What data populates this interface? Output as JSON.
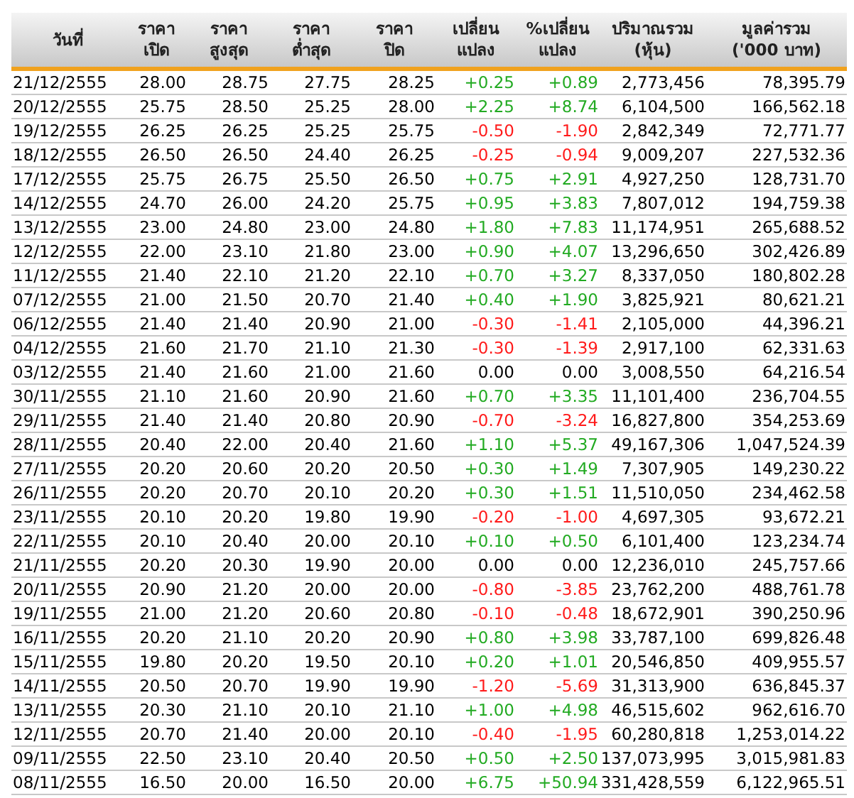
{
  "table": {
    "columns": [
      {
        "lines": [
          "วันที่"
        ]
      },
      {
        "lines": [
          "ราคา",
          "เปิด"
        ]
      },
      {
        "lines": [
          "ราคา",
          "สูงสุด"
        ]
      },
      {
        "lines": [
          "ราคา",
          "ต่ำสุด"
        ]
      },
      {
        "lines": [
          "ราคา",
          "ปิด"
        ]
      },
      {
        "lines": [
          "เปลี่ยน",
          "แปลง"
        ]
      },
      {
        "lines": [
          "%เปลี่ยน",
          "แปลง"
        ]
      },
      {
        "lines": [
          "ปริมาณรวม",
          "(หุ้น)"
        ]
      },
      {
        "lines": [
          "มูลค่ารวม",
          "('000 บาท)"
        ]
      }
    ],
    "rows": [
      {
        "date": "21/12/2555",
        "open": "28.00",
        "high": "28.75",
        "low": "27.75",
        "close": "28.25",
        "change": "+0.25",
        "pct": "+0.89",
        "volume": "2,773,456",
        "value": "78,395.79",
        "color": "#22aa22"
      },
      {
        "date": "20/12/2555",
        "open": "25.75",
        "high": "28.50",
        "low": "25.25",
        "close": "28.00",
        "change": "+2.25",
        "pct": "+8.74",
        "volume": "6,104,500",
        "value": "166,562.18",
        "color": "#22aa22"
      },
      {
        "date": "19/12/2555",
        "open": "26.25",
        "high": "26.25",
        "low": "25.25",
        "close": "25.75",
        "change": "-0.50",
        "pct": "-1.90",
        "volume": "2,842,349",
        "value": "72,771.77",
        "color": "#ff1a1a"
      },
      {
        "date": "18/12/2555",
        "open": "26.50",
        "high": "26.50",
        "low": "24.40",
        "close": "26.25",
        "change": "-0.25",
        "pct": "-0.94",
        "volume": "9,009,207",
        "value": "227,532.36",
        "color": "#ff1a1a"
      },
      {
        "date": "17/12/2555",
        "open": "25.75",
        "high": "26.75",
        "low": "25.50",
        "close": "26.50",
        "change": "+0.75",
        "pct": "+2.91",
        "volume": "4,927,250",
        "value": "128,731.70",
        "color": "#22aa22"
      },
      {
        "date": "14/12/2555",
        "open": "24.70",
        "high": "26.00",
        "low": "24.20",
        "close": "25.75",
        "change": "+0.95",
        "pct": "+3.83",
        "volume": "7,807,012",
        "value": "194,759.38",
        "color": "#22aa22"
      },
      {
        "date": "13/12/2555",
        "open": "23.00",
        "high": "24.80",
        "low": "23.00",
        "close": "24.80",
        "change": "+1.80",
        "pct": "+7.83",
        "volume": "11,174,951",
        "value": "265,688.52",
        "color": "#22aa22"
      },
      {
        "date": "12/12/2555",
        "open": "22.00",
        "high": "23.10",
        "low": "21.80",
        "close": "23.00",
        "change": "+0.90",
        "pct": "+4.07",
        "volume": "13,296,650",
        "value": "302,426.89",
        "color": "#22aa22"
      },
      {
        "date": "11/12/2555",
        "open": "21.40",
        "high": "22.10",
        "low": "21.20",
        "close": "22.10",
        "change": "+0.70",
        "pct": "+3.27",
        "volume": "8,337,050",
        "value": "180,802.28",
        "color": "#22aa22"
      },
      {
        "date": "07/12/2555",
        "open": "21.00",
        "high": "21.50",
        "low": "20.70",
        "close": "21.40",
        "change": "+0.40",
        "pct": "+1.90",
        "volume": "3,825,921",
        "value": "80,621.21",
        "color": "#22aa22"
      },
      {
        "date": "06/12/2555",
        "open": "21.40",
        "high": "21.40",
        "low": "20.90",
        "close": "21.00",
        "change": "-0.30",
        "pct": "-1.41",
        "volume": "2,105,000",
        "value": "44,396.21",
        "color": "#ff1a1a"
      },
      {
        "date": "04/12/2555",
        "open": "21.60",
        "high": "21.70",
        "low": "21.10",
        "close": "21.30",
        "change": "-0.30",
        "pct": "-1.39",
        "volume": "2,917,100",
        "value": "62,331.63",
        "color": "#ff1a1a"
      },
      {
        "date": "03/12/2555",
        "open": "21.40",
        "high": "21.60",
        "low": "21.00",
        "close": "21.60",
        "change": "0.00",
        "pct": "0.00",
        "volume": "3,008,550",
        "value": "64,216.54",
        "color": "#000000"
      },
      {
        "date": "30/11/2555",
        "open": "21.10",
        "high": "21.60",
        "low": "20.90",
        "close": "21.60",
        "change": "+0.70",
        "pct": "+3.35",
        "volume": "11,101,400",
        "value": "236,704.55",
        "color": "#22aa22"
      },
      {
        "date": "29/11/2555",
        "open": "21.40",
        "high": "21.40",
        "low": "20.80",
        "close": "20.90",
        "change": "-0.70",
        "pct": "-3.24",
        "volume": "16,827,800",
        "value": "354,253.69",
        "color": "#ff1a1a"
      },
      {
        "date": "28/11/2555",
        "open": "20.40",
        "high": "22.00",
        "low": "20.40",
        "close": "21.60",
        "change": "+1.10",
        "pct": "+5.37",
        "volume": "49,167,306",
        "value": "1,047,524.39",
        "color": "#22aa22"
      },
      {
        "date": "27/11/2555",
        "open": "20.20",
        "high": "20.60",
        "low": "20.20",
        "close": "20.50",
        "change": "+0.30",
        "pct": "+1.49",
        "volume": "7,307,905",
        "value": "149,230.22",
        "color": "#22aa22"
      },
      {
        "date": "26/11/2555",
        "open": "20.20",
        "high": "20.70",
        "low": "20.10",
        "close": "20.20",
        "change": "+0.30",
        "pct": "+1.51",
        "volume": "11,510,050",
        "value": "234,462.58",
        "color": "#22aa22"
      },
      {
        "date": "23/11/2555",
        "open": "20.10",
        "high": "20.20",
        "low": "19.80",
        "close": "19.90",
        "change": "-0.20",
        "pct": "-1.00",
        "volume": "4,697,305",
        "value": "93,672.21",
        "color": "#ff1a1a"
      },
      {
        "date": "22/11/2555",
        "open": "20.10",
        "high": "20.40",
        "low": "20.00",
        "close": "20.10",
        "change": "+0.10",
        "pct": "+0.50",
        "volume": "6,101,400",
        "value": "123,234.74",
        "color": "#22aa22"
      },
      {
        "date": "21/11/2555",
        "open": "20.20",
        "high": "20.30",
        "low": "19.90",
        "close": "20.00",
        "change": "0.00",
        "pct": "0.00",
        "volume": "12,236,010",
        "value": "245,757.66",
        "color": "#000000"
      },
      {
        "date": "20/11/2555",
        "open": "20.90",
        "high": "21.20",
        "low": "20.00",
        "close": "20.00",
        "change": "-0.80",
        "pct": "-3.85",
        "volume": "23,762,200",
        "value": "488,761.78",
        "color": "#ff1a1a"
      },
      {
        "date": "19/11/2555",
        "open": "21.00",
        "high": "21.20",
        "low": "20.60",
        "close": "20.80",
        "change": "-0.10",
        "pct": "-0.48",
        "volume": "18,672,901",
        "value": "390,250.96",
        "color": "#ff1a1a"
      },
      {
        "date": "16/11/2555",
        "open": "20.20",
        "high": "21.10",
        "low": "20.20",
        "close": "20.90",
        "change": "+0.80",
        "pct": "+3.98",
        "volume": "33,787,100",
        "value": "699,826.48",
        "color": "#22aa22"
      },
      {
        "date": "15/11/2555",
        "open": "19.80",
        "high": "20.20",
        "low": "19.50",
        "close": "20.10",
        "change": "+0.20",
        "pct": "+1.01",
        "volume": "20,546,850",
        "value": "409,955.57",
        "color": "#22aa22"
      },
      {
        "date": "14/11/2555",
        "open": "20.50",
        "high": "20.70",
        "low": "19.90",
        "close": "19.90",
        "change": "-1.20",
        "pct": "-5.69",
        "volume": "31,313,900",
        "value": "636,845.37",
        "color": "#ff1a1a"
      },
      {
        "date": "13/11/2555",
        "open": "20.30",
        "high": "21.10",
        "low": "20.10",
        "close": "21.10",
        "change": "+1.00",
        "pct": "+4.98",
        "volume": "46,515,602",
        "value": "962,616.70",
        "color": "#22aa22"
      },
      {
        "date": "12/11/2555",
        "open": "20.70",
        "high": "21.40",
        "low": "20.00",
        "close": "20.10",
        "change": "-0.40",
        "pct": "-1.95",
        "volume": "60,280,818",
        "value": "1,253,014.22",
        "color": "#ff1a1a"
      },
      {
        "date": "09/11/2555",
        "open": "22.50",
        "high": "23.10",
        "low": "20.40",
        "close": "20.50",
        "change": "+0.50",
        "pct": "+2.50",
        "volume": "137,073,995",
        "value": "3,015,981.83",
        "color": "#22aa22"
      },
      {
        "date": "08/11/2555",
        "open": "16.50",
        "high": "20.00",
        "low": "16.50",
        "close": "20.00",
        "change": "+6.75",
        "pct": "+50.94",
        "volume": "331,428,559",
        "value": "6,122,965.51",
        "color": "#22aa22"
      }
    ]
  }
}
